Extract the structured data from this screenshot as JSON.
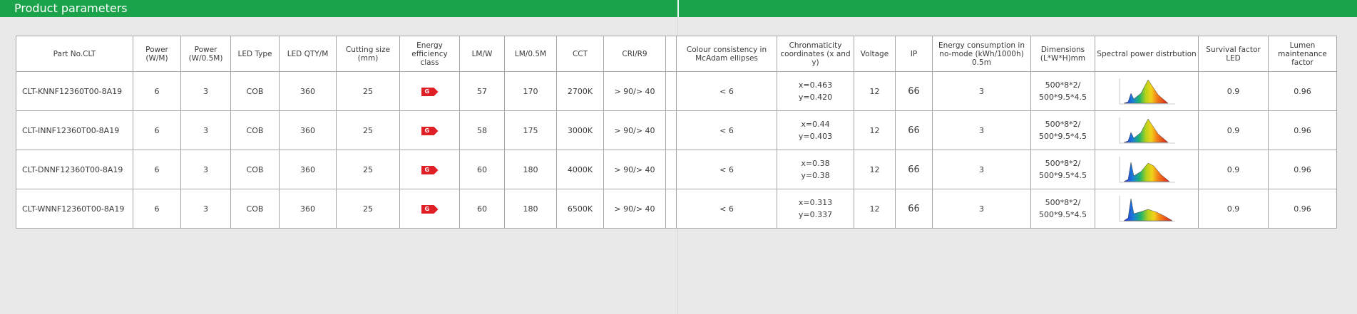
{
  "header": {
    "title": "Product parameters"
  },
  "colors": {
    "brand_green": "#1aa34a",
    "energy_badge": "#e02027"
  },
  "table": {
    "columns": [
      {
        "label": "Part No.CLT"
      },
      {
        "label": "Power (W/M)"
      },
      {
        "label": "Power (W/0.5M)"
      },
      {
        "label": "LED Type"
      },
      {
        "label": "LED QTY/M"
      },
      {
        "label": "Cutting size (mm)"
      },
      {
        "label": "Energy efficiency class"
      },
      {
        "label": "LM/W"
      },
      {
        "label": "LM/0.5M"
      },
      {
        "label": "CCT"
      },
      {
        "label": "CRI/R9"
      },
      {
        "label": "Colour consistency in McAdam ellipses"
      },
      {
        "label": "Chronmaticity coordinates (x and y)"
      },
      {
        "label": "Voltage"
      },
      {
        "label": "IP"
      },
      {
        "label": "Energy consumption in no-mode (kWh/1000h) 0.5m"
      },
      {
        "label": "Dimensions (L*W*H)mm"
      },
      {
        "label": "Spectral power distrbution"
      },
      {
        "label": "Survival factor LED"
      },
      {
        "label": "Lumen maintenance factor"
      }
    ],
    "rows": [
      {
        "part_no": "CLT-KNNF12360T00-8A19",
        "power_wm": "6",
        "power_w05m": "3",
        "led_type": "COB",
        "led_qty": "360",
        "cutting": "25",
        "energy_class": "G",
        "lmw": "57",
        "lm05m": "170",
        "cct": "2700K",
        "cri": "> 90/> 40",
        "mcadam": "< 6",
        "chroma_x": "x=0.463",
        "chroma_y": "y=0.420",
        "voltage": "12",
        "ip": "66",
        "energy_nomode": "3",
        "dim_1": "500*8*2/",
        "dim_2": "500*9.5*4.5",
        "spd_icon": "spectrum-warm-icon",
        "survival": "0.9",
        "lumen_maint": "0.96"
      },
      {
        "part_no": "CLT-INNF12360T00-8A19",
        "power_wm": "6",
        "power_w05m": "3",
        "led_type": "COB",
        "led_qty": "360",
        "cutting": "25",
        "energy_class": "G",
        "lmw": "58",
        "lm05m": "175",
        "cct": "3000K",
        "cri": "> 90/> 40",
        "mcadam": "< 6",
        "chroma_x": "x=0.44",
        "chroma_y": "y=0.403",
        "voltage": "12",
        "ip": "66",
        "energy_nomode": "3",
        "dim_1": "500*8*2/",
        "dim_2": "500*9.5*4.5",
        "spd_icon": "spectrum-warm-icon",
        "survival": "0.9",
        "lumen_maint": "0.96"
      },
      {
        "part_no": "CLT-DNNF12360T00-8A19",
        "power_wm": "6",
        "power_w05m": "3",
        "led_type": "COB",
        "led_qty": "360",
        "cutting": "25",
        "energy_class": "G",
        "lmw": "60",
        "lm05m": "180",
        "cct": "4000K",
        "cri": "> 90/> 40",
        "mcadam": "< 6",
        "chroma_x": "x=0.38",
        "chroma_y": "y=0.38",
        "voltage": "12",
        "ip": "66",
        "energy_nomode": "3",
        "dim_1": "500*8*2/",
        "dim_2": "500*9.5*4.5",
        "spd_icon": "spectrum-neutral-icon",
        "survival": "0.9",
        "lumen_maint": "0.96"
      },
      {
        "part_no": "CLT-WNNF12360T00-8A19",
        "power_wm": "6",
        "power_w05m": "3",
        "led_type": "COB",
        "led_qty": "360",
        "cutting": "25",
        "energy_class": "G",
        "lmw": "60",
        "lm05m": "180",
        "cct": "6500K",
        "cri": "> 90/> 40",
        "mcadam": "< 6",
        "chroma_x": "x=0.313",
        "chroma_y": "y=0.337",
        "voltage": "12",
        "ip": "66",
        "energy_nomode": "3",
        "dim_1": "500*8*2/",
        "dim_2": "500*9.5*4.5",
        "spd_icon": "spectrum-cool-icon",
        "survival": "0.9",
        "lumen_maint": "0.96"
      }
    ]
  }
}
